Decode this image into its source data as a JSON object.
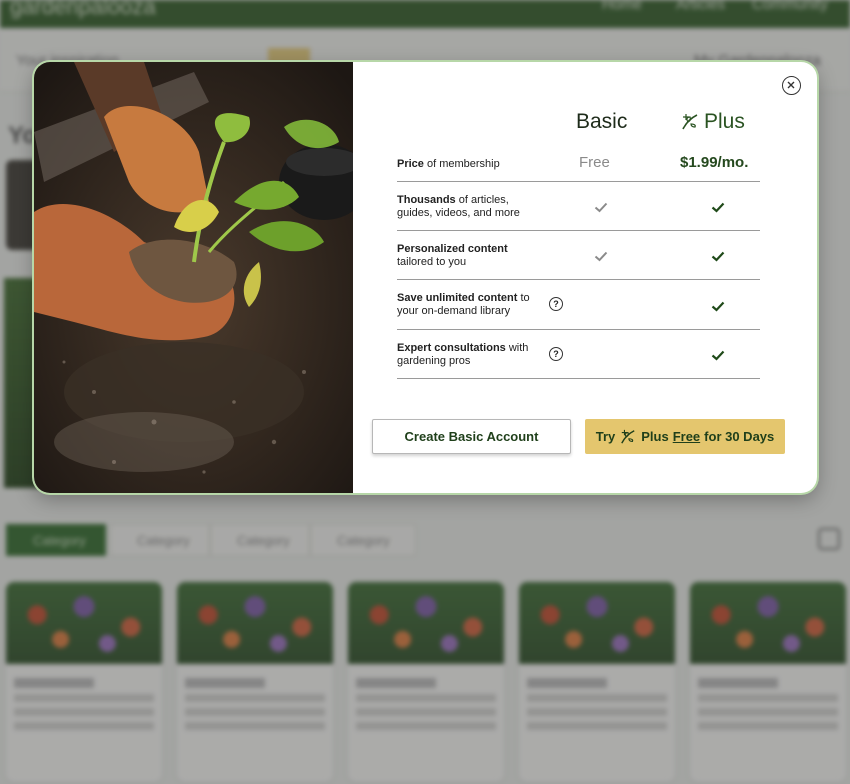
{
  "background": {
    "logo": "gardenpalooza",
    "nav": [
      "Home",
      "Articles",
      "Community"
    ],
    "promo": "Your inspiration",
    "tag": "Sale",
    "account": "My Gardenpalooza",
    "hero_title": "Yo",
    "filters": [
      "Category",
      "Category",
      "Category",
      "Category"
    ],
    "card_title": "Lorem ipsum"
  },
  "modal": {
    "columns": {
      "basic": "Basic",
      "plus": "Plus"
    },
    "price_row": {
      "label_bold": "Price",
      "label_rest": " of membership",
      "basic": "Free",
      "plus": "$1.99/mo."
    },
    "features": [
      {
        "bold": "Thousands",
        "rest": " of articles,",
        "line2": "guides, videos, and more",
        "basic": true,
        "plus": true,
        "help": false
      },
      {
        "bold": "Personalized content",
        "rest": "",
        "line2": "tailored to you",
        "basic": true,
        "plus": true,
        "help": false
      },
      {
        "bold": "Save unlimited content",
        "rest": " to",
        "line2": "your on-demand library",
        "basic": false,
        "plus": true,
        "help": true
      },
      {
        "bold": "Expert consultations",
        "rest": " with",
        "line2": "gardening pros",
        "basic": false,
        "plus": true,
        "help": true
      }
    ],
    "help_glyph": "?",
    "buttons": {
      "basic": "Create Basic Account",
      "plus_try": "Try",
      "plus_name": "Plus",
      "plus_free": "Free",
      "plus_rest": "for 30 Days"
    },
    "colors": {
      "brand_green": "#2a5322",
      "plus_button": "#e4c66e",
      "check_basic": "#8a8a8a",
      "check_plus": "#1f4a19"
    },
    "icons": {
      "close": "close-icon",
      "plus_logo": "leaf-plus-icon",
      "check": "check-icon",
      "help": "help-circle-icon"
    }
  }
}
